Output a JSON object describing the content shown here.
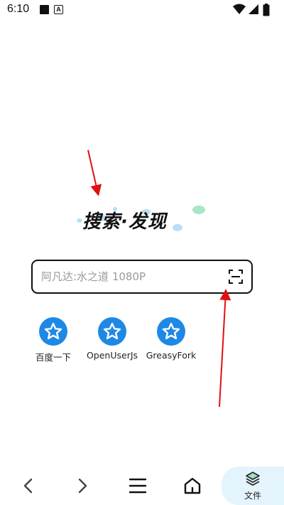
{
  "status_bar": {
    "time": "6:10"
  },
  "logo": {
    "text": "搜索·发现"
  },
  "search": {
    "placeholder": "阿凡达:水之道 1080P",
    "value": ""
  },
  "shortcuts": [
    {
      "label": "百度一下",
      "icon": "star-icon"
    },
    {
      "label": "OpenUserJs",
      "icon": "star-icon"
    },
    {
      "label": "GreasyFork",
      "icon": "star-icon"
    }
  ],
  "bottom_nav": {
    "files_label": "文件"
  },
  "colors": {
    "accent_blue": "#1e88e5",
    "logo_green": "#a8e6c4",
    "logo_blue": "#b8e0f4",
    "annotation_red": "#e01010",
    "files_tab_bg": "#e4f4fc"
  }
}
